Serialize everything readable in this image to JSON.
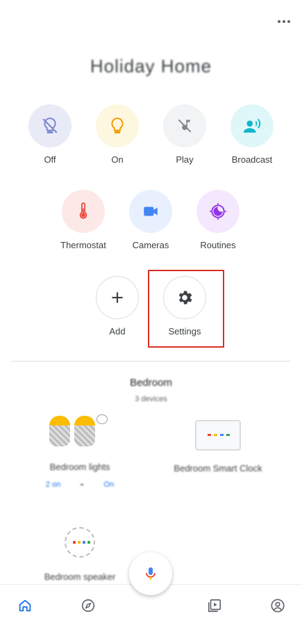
{
  "home": {
    "title": "Holiday Home"
  },
  "actions": {
    "off": "Off",
    "on": "On",
    "play": "Play",
    "broadcast": "Broadcast",
    "thermostat": "Thermostat",
    "cameras": "Cameras",
    "routines": "Routines",
    "add": "Add",
    "settings": "Settings"
  },
  "room": {
    "title": "Bedroom",
    "subtitle": "3 devices",
    "devices": [
      {
        "name": "Bedroom lights",
        "status_left": "2 on",
        "status_right": "On"
      },
      {
        "name": "Bedroom Smart Clock"
      },
      {
        "name": "Bedroom speaker"
      }
    ]
  },
  "colors": {
    "accent": "#1a73e8",
    "highlight": "#d93025",
    "bulb": "#fbbc04"
  },
  "icons": {
    "menu": "more-horiz-icon",
    "off": "lightbulb-off-icon",
    "on": "lightbulb-icon",
    "play": "music-off-icon",
    "broadcast": "broadcast-icon",
    "thermostat": "thermometer-icon",
    "cameras": "videocam-icon",
    "routines": "routine-icon",
    "add": "plus-icon",
    "settings": "gear-icon",
    "mic": "mic-icon",
    "nav_home": "home-icon",
    "nav_explore": "compass-icon",
    "nav_media": "media-icon",
    "nav_account": "account-icon"
  }
}
